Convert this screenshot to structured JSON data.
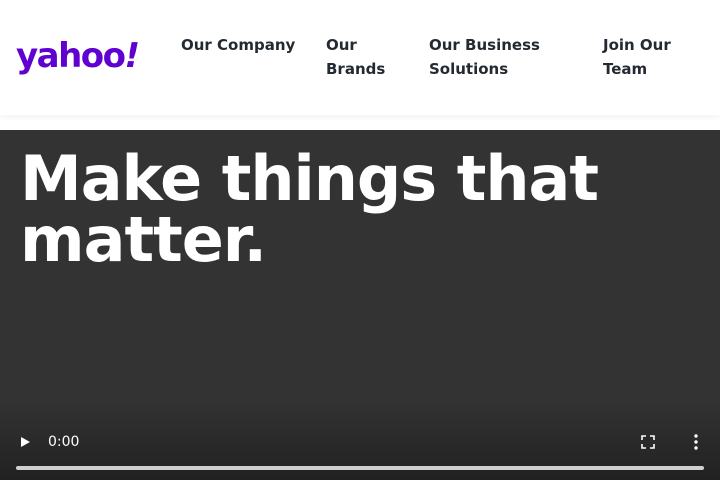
{
  "header": {
    "logo": {
      "text": "yahoo",
      "bang": "!",
      "color": "#6001d2"
    },
    "nav": [
      {
        "label_line1": "Our Company",
        "label_line2": ""
      },
      {
        "label_line1": "Our",
        "label_line2": "Brands"
      },
      {
        "label_line1": "Our Business",
        "label_line2": "Solutions"
      },
      {
        "label_line1": "Join Our",
        "label_line2": "Team"
      }
    ]
  },
  "hero": {
    "title_line1": "Make things that",
    "title_line2": "matter."
  },
  "video_player": {
    "current_time": "0:00",
    "progress": 0,
    "icons": [
      "play-icon",
      "fullscreen-icon",
      "more-options-icon"
    ],
    "background_color": "#333333"
  }
}
